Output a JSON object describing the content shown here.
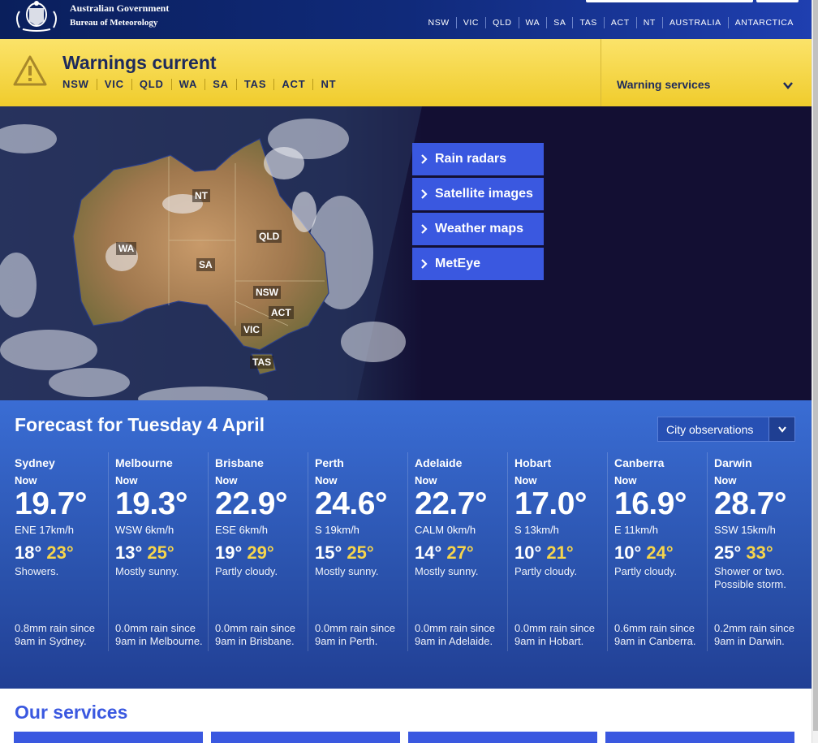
{
  "header": {
    "gov_title": "Australian Government",
    "gov_subtitle": "Bureau of Meteorology",
    "nav": [
      "NSW",
      "VIC",
      "QLD",
      "WA",
      "SA",
      "TAS",
      "ACT",
      "NT",
      "AUSTRALIA",
      "ANTARCTICA"
    ]
  },
  "warnings": {
    "title": "Warnings current",
    "states": [
      "NSW",
      "VIC",
      "QLD",
      "WA",
      "SA",
      "TAS",
      "ACT",
      "NT"
    ],
    "services_label": "Warning services",
    "icon": "warning-triangle-icon",
    "color": "#f2cf32"
  },
  "map": {
    "state_labels": [
      "NT",
      "WA",
      "QLD",
      "SA",
      "NSW",
      "ACT",
      "VIC",
      "TAS"
    ],
    "quick_links": [
      "Rain radars",
      "Satellite images",
      "Weather maps",
      "MetEye"
    ]
  },
  "forecast": {
    "title": "Forecast for Tuesday 4 April",
    "select_value": "City observations",
    "now_label": "Now",
    "cities": [
      {
        "name": "Sydney",
        "temp": "19.7°",
        "wind": "ENE 17km/h",
        "min": "18°",
        "max": "23°",
        "desc": "Showers.",
        "rain": "0.8mm rain since 9am in Sydney."
      },
      {
        "name": "Melbourne",
        "temp": "19.3°",
        "wind": "WSW 6km/h",
        "min": "13°",
        "max": "25°",
        "desc": "Mostly sunny.",
        "rain": "0.0mm rain since 9am in Melbourne."
      },
      {
        "name": "Brisbane",
        "temp": "22.9°",
        "wind": "ESE 6km/h",
        "min": "19°",
        "max": "29°",
        "desc": "Partly cloudy.",
        "rain": "0.0mm rain since 9am in Brisbane."
      },
      {
        "name": "Perth",
        "temp": "24.6°",
        "wind": "S 19km/h",
        "min": "15°",
        "max": "25°",
        "desc": "Mostly sunny.",
        "rain": "0.0mm rain since 9am in Perth."
      },
      {
        "name": "Adelaide",
        "temp": "22.7°",
        "wind": "CALM 0km/h",
        "min": "14°",
        "max": "27°",
        "desc": "Mostly sunny.",
        "rain": "0.0mm rain since 9am in Adelaide."
      },
      {
        "name": "Hobart",
        "temp": "17.0°",
        "wind": "S 13km/h",
        "min": "10°",
        "max": "21°",
        "desc": "Partly cloudy.",
        "rain": "0.0mm rain since 9am in Hobart."
      },
      {
        "name": "Canberra",
        "temp": "16.9°",
        "wind": "E 11km/h",
        "min": "10°",
        "max": "24°",
        "desc": "Partly cloudy.",
        "rain": "0.6mm rain since 9am in Canberra."
      },
      {
        "name": "Darwin",
        "temp": "28.7°",
        "wind": "SSW 15km/h",
        "min": "25°",
        "max": "33°",
        "desc": "Shower or two. Possible storm.",
        "rain": "0.2mm rain since 9am in Darwin."
      }
    ]
  },
  "services": {
    "title": "Our services"
  },
  "colors": {
    "accent": "#3a58e0",
    "header_dark": "#0a1f5c",
    "forecast_blue": "#2a52ac",
    "max_temp": "#f6d54c"
  }
}
